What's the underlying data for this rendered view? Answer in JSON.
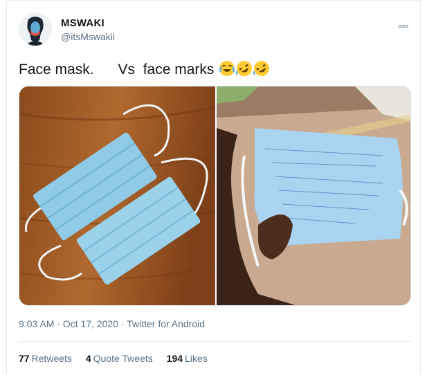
{
  "author": {
    "display_name": "MSWAKI",
    "handle": "@itsMswakii"
  },
  "menu_icon": "more-horizontal-icon",
  "tweet": {
    "text": "Face mask.      Vs  face marks ",
    "emojis": [
      "face-with-tears-of-joy-icon",
      "rolling-on-floor-laughing-icon",
      "rolling-on-floor-laughing-icon"
    ]
  },
  "media": {
    "left_image": "surgical-face-masks-on-wooden-table",
    "right_image": "hand-holding-mask-with-handwritten-notes"
  },
  "meta": {
    "time": "9:03 AM",
    "separator": " · ",
    "date": "Oct 17, 2020",
    "source": "Twitter for Android"
  },
  "stats": {
    "retweets_count": "77",
    "retweets_label": "Retweets",
    "quotes_count": "4",
    "quotes_label": "Quote Tweets",
    "likes_count": "194",
    "likes_label": "Likes"
  },
  "colors": {
    "text_primary": "#0f1419",
    "text_secondary": "#5b7083",
    "border": "#e6ecf0"
  }
}
